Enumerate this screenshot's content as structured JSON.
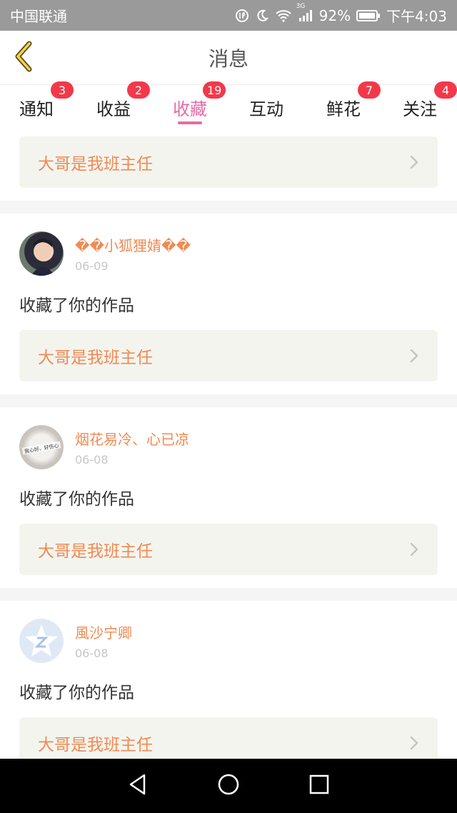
{
  "status_bar": {
    "carrier": "中国联通",
    "network": "3G",
    "battery": "92%",
    "time": "下午4:03",
    "icons": [
      "data-saver-icon",
      "moon-icon",
      "wifi-icon",
      "signal-icon",
      "battery-icon"
    ]
  },
  "header": {
    "title": "消息",
    "back_icon": "chevron-left-icon"
  },
  "tabs": [
    {
      "label": "通知",
      "badge": "3",
      "active": false
    },
    {
      "label": "收益",
      "badge": "2",
      "active": false
    },
    {
      "label": "收藏",
      "badge": "19",
      "active": true
    },
    {
      "label": "互动",
      "badge": "",
      "active": false
    },
    {
      "label": "鲜花",
      "badge": "7",
      "active": false
    },
    {
      "label": "关注",
      "badge": "4",
      "active": false
    }
  ],
  "colors": {
    "accent": "#e86aa6",
    "badge": "#f2394a",
    "work_title": "#f08a53",
    "username": "#f08a53"
  },
  "first_card": {
    "work_title": "大哥是我班主任"
  },
  "items": [
    {
      "username": "��小狐狸婧��",
      "date": "06-09",
      "action": "收藏了你的作品",
      "work_title": "大哥是我班主任"
    },
    {
      "username": "烟花易冷、心已凉",
      "date": "06-08",
      "action": "收藏了你的作品",
      "work_title": "大哥是我班主任",
      "avatar_text": "我心好、好伤心"
    },
    {
      "username": "風沙宁卿",
      "date": "06-08",
      "action": "收藏了你的作品",
      "work_title": "大哥是我班主任"
    }
  ],
  "nav_bar": {
    "icons": [
      "back-triangle-icon",
      "home-circle-icon",
      "recents-square-icon"
    ]
  }
}
